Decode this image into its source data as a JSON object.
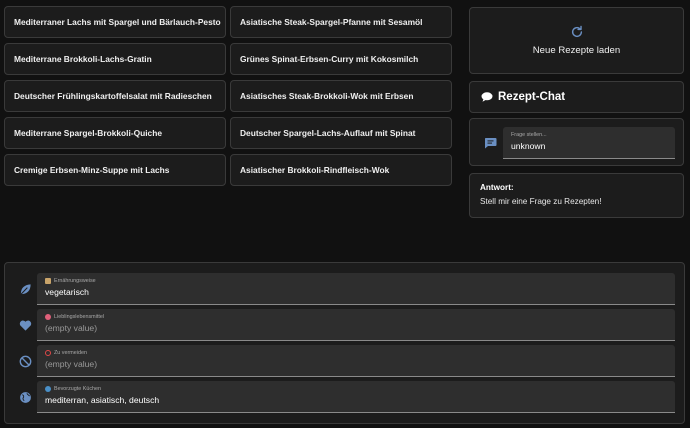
{
  "recipes": [
    "Mediterraner Lachs mit Spargel und Bärlauch-Pesto",
    "Asiatische Steak-Spargel-Pfanne mit Sesamöl",
    "Mediterrane Brokkoli-Lachs-Gratin",
    "Grünes Spinat-Erbsen-Curry mit Kokosmilch",
    "Deutscher Frühlingskartoffelsalat mit Radieschen",
    "Asiatisches Steak-Brokkoli-Wok mit Erbsen",
    "Mediterrane Spargel-Brokkoli-Quiche",
    "Deutscher Spargel-Lachs-Auflauf mit Spinat",
    "Cremige Erbsen-Minz-Suppe mit Lachs",
    "Asiatischer Brokkoli-Rindfleisch-Wok"
  ],
  "reload": {
    "label": "Neue Rezepte laden",
    "icon": "refresh-icon"
  },
  "chat": {
    "title": "Rezept-Chat",
    "icon": "speech-bubble-icon",
    "question_label": "Frage stellen...",
    "question_value": "unknown",
    "question_icon": "chat-icon",
    "answer_title": "Antwort:",
    "answer_text": "Stell mir eine Frage zu Rezepten!"
  },
  "preferences": {
    "diet": {
      "label": "Ernährungsweise",
      "value": "vegetarisch",
      "icon": "leaf-icon"
    },
    "favorites": {
      "label": "Lieblingslebensmittel",
      "value": "(empty value)",
      "icon": "heart-icon"
    },
    "avoid": {
      "label": "Zu vermeiden",
      "value": "(empty value)",
      "icon": "block-icon"
    },
    "cuisines": {
      "label": "Bevorzugte Küchen",
      "value": "mediterran, asiatisch, deutsch",
      "icon": "globe-icon"
    }
  },
  "colors": {
    "accent": "#6a8fc2",
    "background": "#111111",
    "card": "#1c1c1c",
    "field": "#2e2e2e"
  }
}
